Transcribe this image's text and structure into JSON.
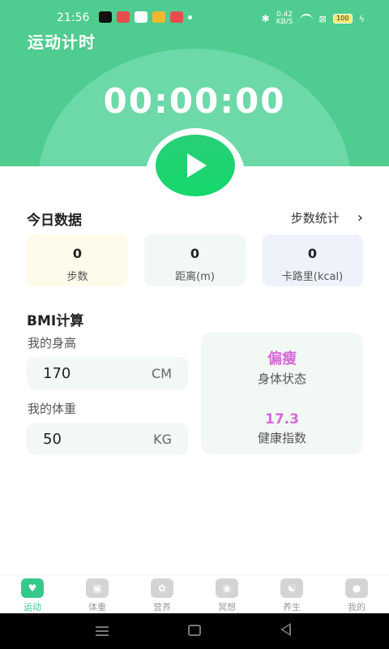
{
  "status_bar": {
    "time": "21:56",
    "net_speed_value": "0.42",
    "net_speed_unit": "KB/S",
    "battery": "100"
  },
  "header": {
    "title": "运动计时",
    "timer": "00:00:00"
  },
  "today": {
    "title": "今日数据",
    "link_label": "步数统计",
    "stats": [
      {
        "value": "0",
        "label": "步数",
        "bg": "#fffbea"
      },
      {
        "value": "0",
        "label": "距离(m)",
        "bg": "#f2f8f3"
      },
      {
        "value": "0",
        "label": "卡路里(kcal)",
        "bg": "#eef3fb"
      }
    ]
  },
  "bmi": {
    "title": "BMI计算",
    "height_label": "我的身高",
    "height_value": "170",
    "height_unit": "CM",
    "weight_label": "我的体重",
    "weight_value": "50",
    "weight_unit": "KG",
    "status_value": "偏瘦",
    "status_label": "身体状态",
    "index_value": "17.3",
    "index_label": "健康指数"
  },
  "tabs": [
    {
      "label": "运动",
      "icon": "heartbeat-icon",
      "active": true
    },
    {
      "label": "体重",
      "icon": "scale-icon",
      "active": false
    },
    {
      "label": "营养",
      "icon": "flower-icon",
      "active": false
    },
    {
      "label": "冥想",
      "icon": "meditation-icon",
      "active": false
    },
    {
      "label": "养生",
      "icon": "yin-yang-icon",
      "active": false
    },
    {
      "label": "我的",
      "icon": "user-icon",
      "active": false
    }
  ],
  "colors": {
    "brand_green": "#4fcc8f",
    "accent_pink": "#d56ad8",
    "tab_active": "#36c98c"
  }
}
